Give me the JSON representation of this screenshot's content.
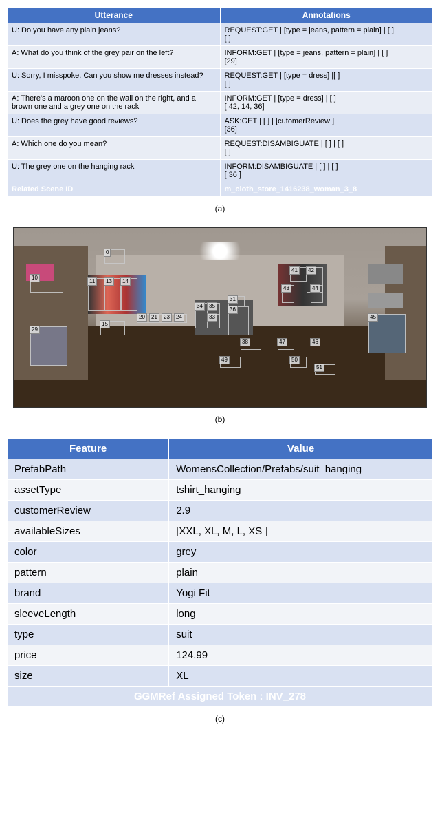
{
  "tableA": {
    "headers": [
      "Utterance",
      "Annotations"
    ],
    "rows": [
      {
        "utt": "U: Do you have any plain jeans?",
        "ann": "REQUEST:GET | [type = jeans, pattern = plain] | [ ]\n[ ]"
      },
      {
        "utt": "A: What do you think of the grey pair on the left?",
        "ann": "INFORM:GET | [type = jeans, pattern = plain] | [ ]\n[29]"
      },
      {
        "utt": "U: Sorry, I misspoke. Can you show me dresses instead?",
        "ann": "REQUEST:GET | [type = dress] |[ ]\n[ ]"
      },
      {
        "utt": "A: There's a maroon one on the wall on the right, and a brown one and a grey one on the rack",
        "ann": "INFORM:GET | [type = dress] | [ ]\n[ 42, 14, 36]"
      },
      {
        "utt": "U: Does the grey have good reviews?",
        "ann": "ASK:GET | [ ] | [cutomerReview ]\n[36]"
      },
      {
        "utt": "A: Which one do you mean?",
        "ann": "REQUEST:DISAMBIGUATE | [ ] | [ ]\n[ ]"
      },
      {
        "utt": "U:  The grey one on the hanging rack",
        "ann": "INFORM:DISAMBIGUATE | [ ] | [ ]\n[ 36 ]"
      }
    ],
    "footer": {
      "label": "Related Scene ID",
      "value": "m_cloth_store_1416238_woman_3_8"
    }
  },
  "captions": {
    "a": "(a)",
    "b": "(b)",
    "c": "(c)"
  },
  "scene": {
    "boxes": [
      {
        "n": "10",
        "l": 4,
        "t": 26,
        "w": 8,
        "h": 10
      },
      {
        "n": "0",
        "l": 22,
        "t": 12,
        "w": 5,
        "h": 8
      },
      {
        "n": "11",
        "l": 18,
        "t": 28,
        "w": 4,
        "h": 18
      },
      {
        "n": "13",
        "l": 22,
        "t": 28,
        "w": 4,
        "h": 18
      },
      {
        "n": "14",
        "l": 26,
        "t": 28,
        "w": 4,
        "h": 18
      },
      {
        "n": "29",
        "l": 4,
        "t": 55,
        "w": 9,
        "h": 22
      },
      {
        "n": "15",
        "l": 21,
        "t": 52,
        "w": 6,
        "h": 8
      },
      {
        "n": "20",
        "l": 30,
        "t": 48,
        "w": 3,
        "h": 5
      },
      {
        "n": "21",
        "l": 33,
        "t": 48,
        "w": 3,
        "h": 5
      },
      {
        "n": "23",
        "l": 36,
        "t": 48,
        "w": 3,
        "h": 5
      },
      {
        "n": "24",
        "l": 39,
        "t": 48,
        "w": 3,
        "h": 5
      },
      {
        "n": "34",
        "l": 44,
        "t": 42,
        "w": 3,
        "h": 14
      },
      {
        "n": "35",
        "l": 47,
        "t": 42,
        "w": 3,
        "h": 14
      },
      {
        "n": "33",
        "l": 47,
        "t": 48,
        "w": 3,
        "h": 8
      },
      {
        "n": "31",
        "l": 52,
        "t": 38,
        "w": 4,
        "h": 6
      },
      {
        "n": "36",
        "l": 52,
        "t": 44,
        "w": 5,
        "h": 16
      },
      {
        "n": "41",
        "l": 67,
        "t": 22,
        "w": 4,
        "h": 8
      },
      {
        "n": "42",
        "l": 71,
        "t": 22,
        "w": 4,
        "h": 14
      },
      {
        "n": "43",
        "l": 65,
        "t": 32,
        "w": 3,
        "h": 10
      },
      {
        "n": "44",
        "l": 72,
        "t": 32,
        "w": 3,
        "h": 10
      },
      {
        "n": "38",
        "l": 55,
        "t": 62,
        "w": 5,
        "h": 6
      },
      {
        "n": "47",
        "l": 64,
        "t": 62,
        "w": 4,
        "h": 6
      },
      {
        "n": "46",
        "l": 72,
        "t": 62,
        "w": 5,
        "h": 8
      },
      {
        "n": "49",
        "l": 50,
        "t": 72,
        "w": 5,
        "h": 6
      },
      {
        "n": "50",
        "l": 67,
        "t": 72,
        "w": 4,
        "h": 6
      },
      {
        "n": "51",
        "l": 73,
        "t": 76,
        "w": 5,
        "h": 6
      },
      {
        "n": "45",
        "l": 86,
        "t": 48,
        "w": 9,
        "h": 22
      }
    ]
  },
  "tableC": {
    "headers": [
      "Feature",
      "Value"
    ],
    "rows": [
      {
        "f": "PrefabPath",
        "v": "WomensCollection/Prefabs/suit_hanging"
      },
      {
        "f": "assetType",
        "v": "tshirt_hanging"
      },
      {
        "f": "customerReview",
        "v": "2.9"
      },
      {
        "f": "availableSizes",
        "v": "[XXL, XL, M, L, XS ]"
      },
      {
        "f": "color",
        "v": "grey"
      },
      {
        "f": "pattern",
        "v": "plain"
      },
      {
        "f": "brand",
        "v": "Yogi Fit"
      },
      {
        "f": "sleeveLength",
        "v": "long"
      },
      {
        "f": "type",
        "v": "suit"
      },
      {
        "f": "price",
        "v": "124.99"
      },
      {
        "f": "size",
        "v": "XL"
      }
    ],
    "footer": "GGMRef Assigned Token  : INV_278"
  }
}
